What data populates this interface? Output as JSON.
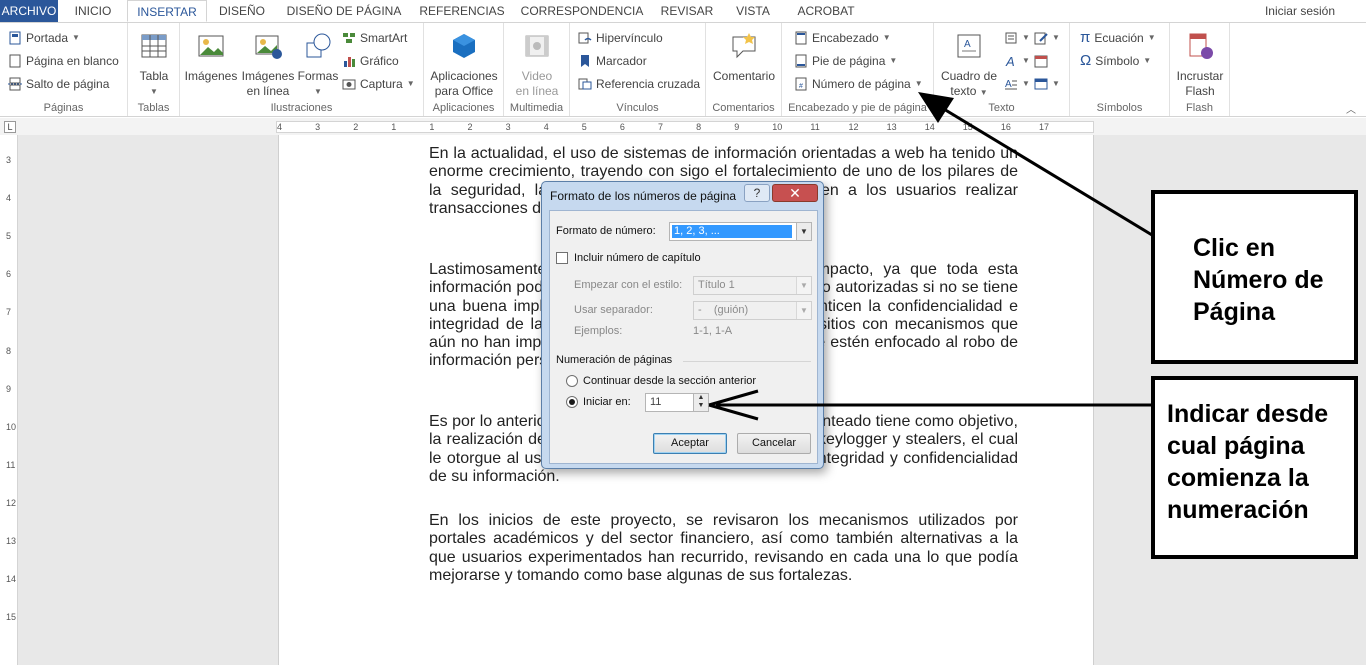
{
  "tabs": {
    "file": "ARCHIVO",
    "items": [
      "INICIO",
      "INSERTAR",
      "DISEÑO",
      "DISEÑO DE PÁGINA",
      "REFERENCIAS",
      "CORRESPONDENCIA",
      "REVISAR",
      "VISTA",
      "ACROBAT"
    ],
    "active": "INSERTAR",
    "signin": "Iniciar sesión"
  },
  "ribbon": {
    "paginas": {
      "label": "Páginas",
      "portada": "Portada",
      "en_blanco": "Página en blanco",
      "salto": "Salto de página"
    },
    "tablas": {
      "label": "Tablas",
      "tabla": "Tabla"
    },
    "ilustraciones": {
      "label": "Ilustraciones",
      "imagenes": "Imágenes",
      "imagenes_linea_1": "Imágenes",
      "imagenes_linea_2": "en línea",
      "formas": "Formas",
      "smartart": "SmartArt",
      "grafico": "Gráfico",
      "captura": "Captura"
    },
    "aplicaciones": {
      "label": "Aplicaciones",
      "line1": "Aplicaciones",
      "line2": "para Office"
    },
    "multimedia": {
      "label": "Multimedia",
      "line1": "Video",
      "line2": "en línea"
    },
    "vinculos": {
      "label": "Vínculos",
      "hipervinculo": "Hipervínculo",
      "marcador": "Marcador",
      "referencia": "Referencia cruzada"
    },
    "comentarios": {
      "label": "Comentarios",
      "comentario": "Comentario"
    },
    "encabezado": {
      "label": "Encabezado y pie de página",
      "encabezado": "Encabezado",
      "pie": "Pie de página",
      "numero": "Número de página"
    },
    "texto": {
      "label": "Texto",
      "line1": "Cuadro de",
      "line2": "texto"
    },
    "simbolos": {
      "label": "Símbolos",
      "ecuacion": "Ecuación",
      "simbolo": "Símbolo"
    },
    "flash": {
      "label": "Flash",
      "line1": "Incrustar",
      "line2": "Flash"
    }
  },
  "ruler": {
    "h_ticks": [
      "4",
      "3",
      "2",
      "1",
      "1",
      "2",
      "3",
      "4",
      "5",
      "6",
      "7",
      "8",
      "9",
      "10",
      "11",
      "12",
      "13",
      "14",
      "15",
      "16",
      "17"
    ],
    "v_ticks": [
      "3",
      "4",
      "5",
      "6",
      "7",
      "8",
      "9",
      "10",
      "11",
      "12",
      "13",
      "14",
      "15"
    ]
  },
  "document": {
    "p1": "En la actualidad, el uso de sistemas de información orientadas a web ha tenido un enorme crecimiento, trayendo con sigo el fortalecimiento de uno de los pilares de la seguridad, la disponibilidad, ya que estos permiten a los usuarios realizar transacciones desde cualquier punto geográfico.",
    "p2": "Lastimosamente esto trae un efecto negativo de impacto, ya que toda esta información podría resultar alcanzable para personas no autorizadas si no se tiene una buena implementación de mecanismos que garanticen la confidencialidad e integridad de la información, encontrándose muchos sitios con mecanismos que aún no han implementado esquemas de seguridad que estén enfocado al robo de información personal.",
    "p3": "Es por lo anteriormente expuesto que este proyecto planteado tiene como objetivo, la realización de un portal que esté protegido frente a keylogger y stealers, el cual le otorgue al usuario final tranquilidad en cuanto a la integridad y confidencialidad de su información.",
    "p4": "En los inicios de este proyecto, se revisaron los mecanismos utilizados por portales académicos y del sector financiero, así como también alternativas a la que usuarios experimentados han recurrido, revisando en cada una lo que podía mejorarse y tomando como base algunas de sus fortalezas."
  },
  "dialog": {
    "title": "Formato de los números de página",
    "help": "?",
    "close": "✕",
    "formato_label": "Formato de número:",
    "formato_value": "1, 2, 3, ...",
    "incluir_capitulo": "Incluir número de capítulo",
    "empezar_label": "Empezar con el estilo:",
    "empezar_value": "Título 1",
    "separador_label": "Usar separador:",
    "separador_value": "-    (guión)",
    "ejemplos_label": "Ejemplos:",
    "ejemplos_value": "1-1, 1-A",
    "numeracion_title": "Numeración de páginas",
    "continuar": "Continuar desde la sección anterior",
    "iniciar_label": "Iniciar en:",
    "iniciar_value": "11",
    "aceptar": "Aceptar",
    "cancelar": "Cancelar"
  },
  "annotations": {
    "callout1": [
      "Clic en",
      "Número de",
      "Página"
    ],
    "callout2": [
      "Indicar desde",
      "cual página",
      "comienza la",
      "numeración"
    ]
  },
  "colors": {
    "file_tab": "#2b579a",
    "dialog_frame": "#c6d9ef",
    "selection": "#3399ff"
  }
}
